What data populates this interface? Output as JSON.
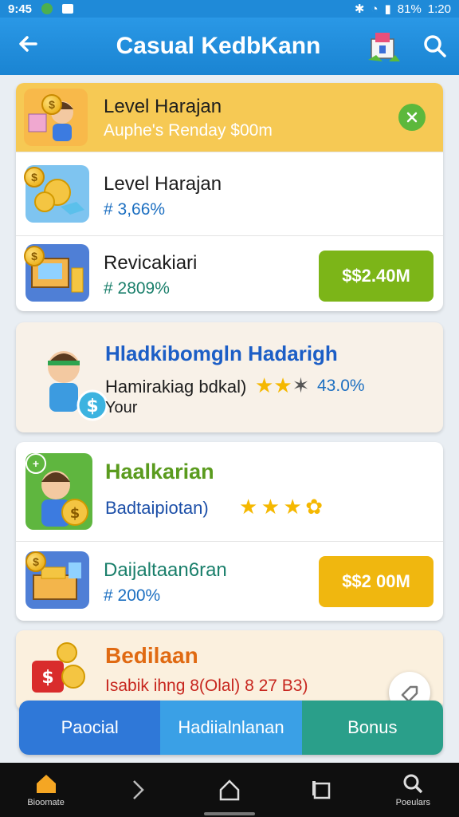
{
  "status": {
    "time": "9:45",
    "battery": "81%",
    "clock_right": "1:20"
  },
  "appbar": {
    "title": "Casual KedbKann",
    "back_icon": "back-arrow-icon",
    "gift_icon": "gift-icon",
    "search_icon": "search-icon"
  },
  "card1": {
    "row1": {
      "title": "Level Harajan",
      "subtitle": "Auphe's Renday $00m",
      "action_icon": "close-icon",
      "bg": "#f6c954"
    },
    "row2": {
      "title": "Level Harajan",
      "value": "# 3,66%"
    },
    "row3": {
      "title": "Revicakiari",
      "value": "# 2809%",
      "button": "$$2.40M",
      "button_color": "#7cb518"
    }
  },
  "card2": {
    "title": "Hladkibomgln  Hadarigh",
    "line1": "Hamirakiag bdkal)",
    "percent": "43.0%",
    "line2": "Your"
  },
  "card3": {
    "row1": {
      "title": "Haalkarian",
      "subtitle": "Badtaipiotan)"
    },
    "row2": {
      "title": "Daijaltaan6ran",
      "value": "# 200%",
      "button": "$$2 00M",
      "button_color": "#f0b70f"
    }
  },
  "card4": {
    "title": "Bedilaan",
    "line": "Isabik ihng 8(Olal)  8 27 B3)"
  },
  "tabs": [
    {
      "label": "Paocial",
      "color": "#2f78d8"
    },
    {
      "label": "Hadiialnlanan",
      "color": "#3aa0e6"
    },
    {
      "label": "Bonus",
      "color": "#2a9f8a"
    }
  ],
  "navbar": {
    "home_label": "Bioomate",
    "search_label": "Poeulars"
  }
}
